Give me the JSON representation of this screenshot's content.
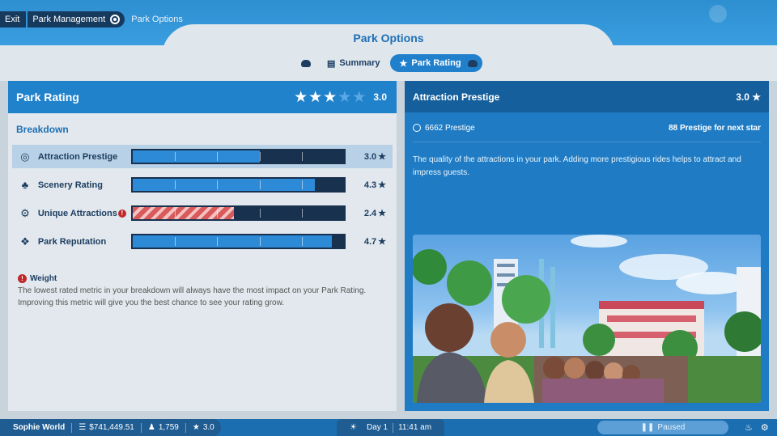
{
  "breadcrumb": {
    "exit": "Exit",
    "park_management": "Park Management",
    "park_options": "Park Options"
  },
  "page_title": "Park Options",
  "tabs": [
    {
      "label": "Summary",
      "icon": "clipboard-icon",
      "active": false
    },
    {
      "label": "Park Rating",
      "icon": "star-icon",
      "active": true
    }
  ],
  "park_rating": {
    "title": "Park Rating",
    "stars_filled": 3,
    "stars_total": 5,
    "value": "3.0",
    "breakdown_title": "Breakdown",
    "metrics": [
      {
        "label": "Attraction Prestige",
        "icon": "prestige-icon",
        "value": "3.0",
        "fill": 0.6,
        "warning": false,
        "selected": true
      },
      {
        "label": "Scenery Rating",
        "icon": "tree-icon",
        "value": "4.3",
        "fill": 0.86,
        "warning": false,
        "selected": false
      },
      {
        "label": "Unique Attractions",
        "icon": "gear-icon",
        "value": "2.4",
        "fill": 0.48,
        "warning": true,
        "selected": false
      },
      {
        "label": "Park Reputation",
        "icon": "reputation-icon",
        "value": "4.7",
        "fill": 0.94,
        "warning": false,
        "selected": false
      }
    ],
    "weight_title": "Weight",
    "weight_text_1": "The lowest rated metric in your breakdown will always have the most impact on your Park Rating.",
    "weight_text_2": "Improving this metric will give you the best chance to see your rating grow."
  },
  "detail": {
    "title": "Attraction Prestige",
    "value": "3.0",
    "prestige": "6662 Prestige",
    "next_star": "88 Prestige for next star",
    "description": "The quality of the attractions in your park. Adding more prestigious rides helps to attract and impress guests."
  },
  "status_bar": {
    "park_name": "Sophie World",
    "money": "$741,449.51",
    "guests": "1,759",
    "rating": "3.0",
    "day": "Day 1",
    "time": "11:41 am",
    "state": "Paused"
  },
  "colors": {
    "accent": "#2182cc",
    "warning": "#c0282c",
    "panel": "#e2e8ed"
  }
}
